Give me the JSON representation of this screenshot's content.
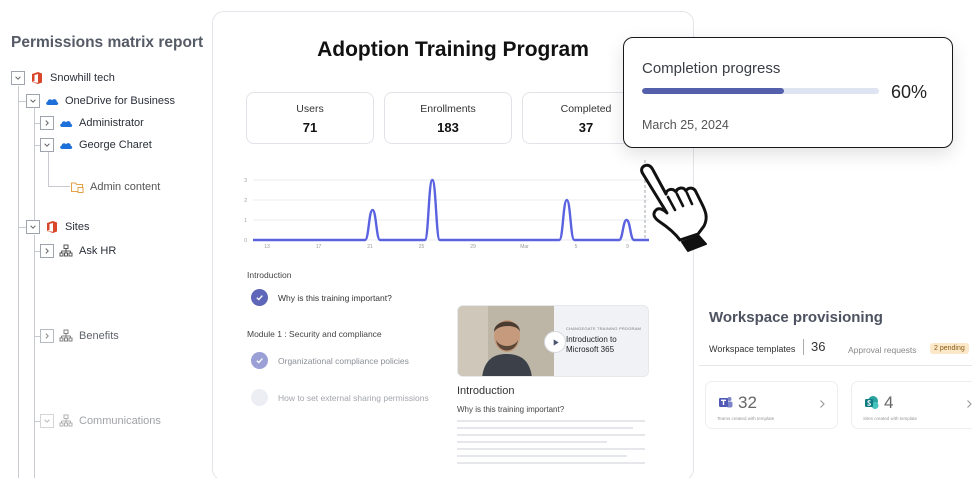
{
  "permissions": {
    "title": "Permissions matrix report",
    "tree": [
      {
        "label": "Snowhill tech",
        "icon": "office-icon",
        "expanded": true
      },
      {
        "label": "OneDrive for Business",
        "icon": "onedrive-icon",
        "expanded": true
      },
      {
        "label": "Administrator",
        "icon": "onedrive-icon",
        "expanded": false
      },
      {
        "label": "George Charet",
        "icon": "onedrive-icon",
        "expanded": true
      },
      {
        "label": "Admin content",
        "icon": "folder-icon"
      },
      {
        "label": "Sites",
        "icon": "office-icon",
        "expanded": true
      },
      {
        "label": "Ask HR",
        "icon": "sitemap-icon",
        "expanded": false
      },
      {
        "label": "Benefits",
        "icon": "sitemap-icon",
        "expanded": false
      },
      {
        "label": "Communications",
        "icon": "sitemap-icon",
        "expanded": true
      }
    ]
  },
  "program": {
    "title": "Adoption Training Program",
    "stats": [
      {
        "label": "Users",
        "value": "71"
      },
      {
        "label": "Enrollments",
        "value": "183"
      },
      {
        "label": "Completed",
        "value": "37"
      }
    ],
    "sections": [
      {
        "label": "Introduction"
      },
      {
        "label": "Module 1 : Security and compliance"
      }
    ],
    "lessons": [
      {
        "label": "Why is this training important?",
        "state": "done"
      },
      {
        "label": "Organizational compliance policies",
        "state": "done-faded"
      },
      {
        "label": "How to set external sharing permissions",
        "state": "todo"
      }
    ],
    "video": {
      "kicker": "CHANGEGATE TRAINING PROGRAM",
      "title": "Introduction to Microsoft 365"
    },
    "intro_heading": "Introduction",
    "intro_question": "Why is this training important?"
  },
  "chart_data": {
    "type": "line",
    "title": "",
    "xlabel": "",
    "ylabel": "",
    "ylim": [
      0,
      3
    ],
    "yticks": [
      "0",
      "1",
      "2",
      "3"
    ],
    "xticks": [
      "13",
      "17",
      "21",
      "25",
      "29",
      "Mar",
      "5",
      "9"
    ],
    "grid": true,
    "series": [
      {
        "points": [
          [
            13,
            0
          ],
          [
            20.5,
            0
          ],
          [
            21,
            1.5
          ],
          [
            21.5,
            0
          ],
          [
            24.5,
            0
          ],
          [
            25,
            3
          ],
          [
            25.5,
            0
          ],
          [
            33.5,
            0
          ],
          [
            34,
            2
          ],
          [
            34.5,
            0
          ],
          [
            37.5,
            0
          ],
          [
            38,
            1
          ],
          [
            38.5,
            0
          ],
          [
            39.5,
            0
          ]
        ]
      }
    ],
    "colors": {
      "line": "#5a62e0"
    }
  },
  "completion": {
    "title": "Completion progress",
    "percent": 60,
    "percent_label": "60%",
    "date": "March 25, 2024",
    "colors": {
      "fill": "#5560ad",
      "track": "#dfe4f2"
    }
  },
  "workspace": {
    "title": "Workspace provisioning",
    "tab_templates": "Workspace templates",
    "templates_count": "36",
    "tab_approvals": "Approval requests",
    "pending_badge": "2 pending",
    "tiles": [
      {
        "icon": "teams-icon",
        "count": "32",
        "caption": "Teams created with template"
      },
      {
        "icon": "sharepoint-icon",
        "count": "4",
        "caption": "Sites created with template"
      }
    ]
  }
}
